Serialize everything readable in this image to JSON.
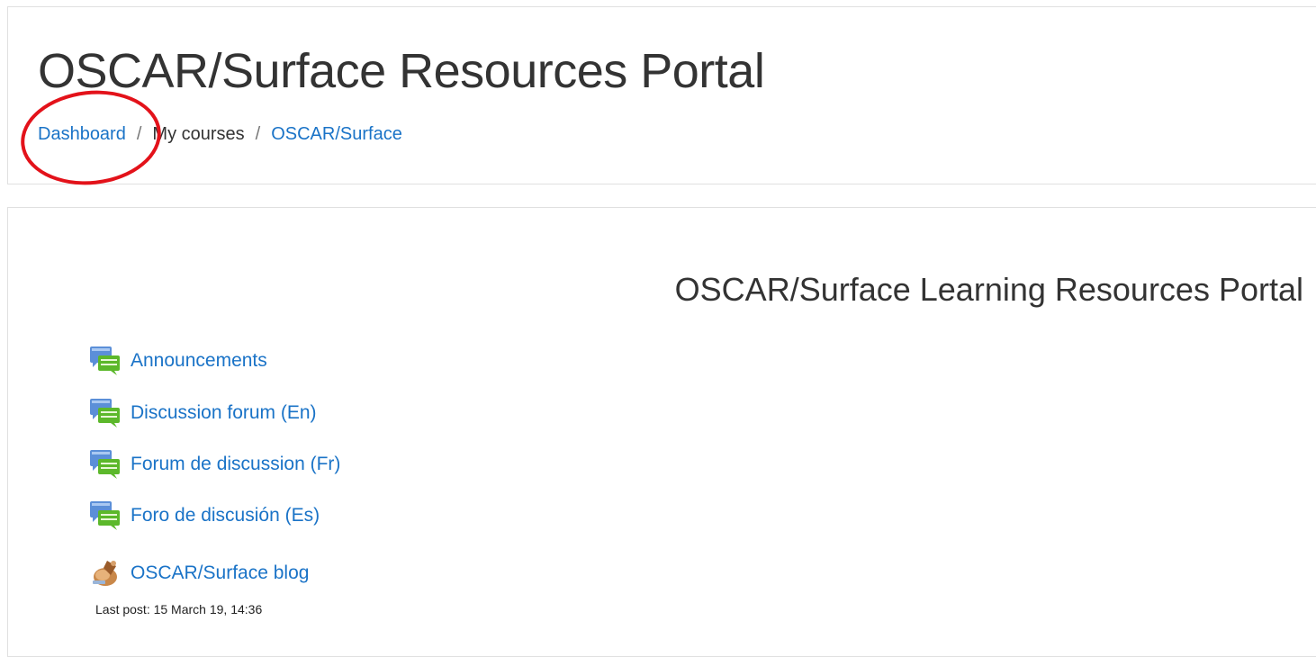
{
  "header": {
    "title": "OSCAR/Surface Resources Portal",
    "breadcrumb": {
      "dashboard": "Dashboard",
      "separator": "/",
      "my_courses": "My courses",
      "course": "OSCAR/Surface"
    }
  },
  "main": {
    "heading": "OSCAR/Surface Learning Resources Portal",
    "activities": [
      {
        "label": "Announcements",
        "icon": "forum-icon"
      },
      {
        "label": "Discussion forum (En)",
        "icon": "forum-icon"
      },
      {
        "label": "Forum de discussion (Fr)",
        "icon": "forum-icon"
      },
      {
        "label": "Foro de discusión (Es)",
        "icon": "forum-icon"
      },
      {
        "label": "OSCAR/Surface blog",
        "icon": "blog-icon"
      }
    ],
    "last_post": "Last post: 15 March 19, 14:36"
  },
  "colors": {
    "link": "#1a73c7",
    "annotation": "#e3121a"
  }
}
